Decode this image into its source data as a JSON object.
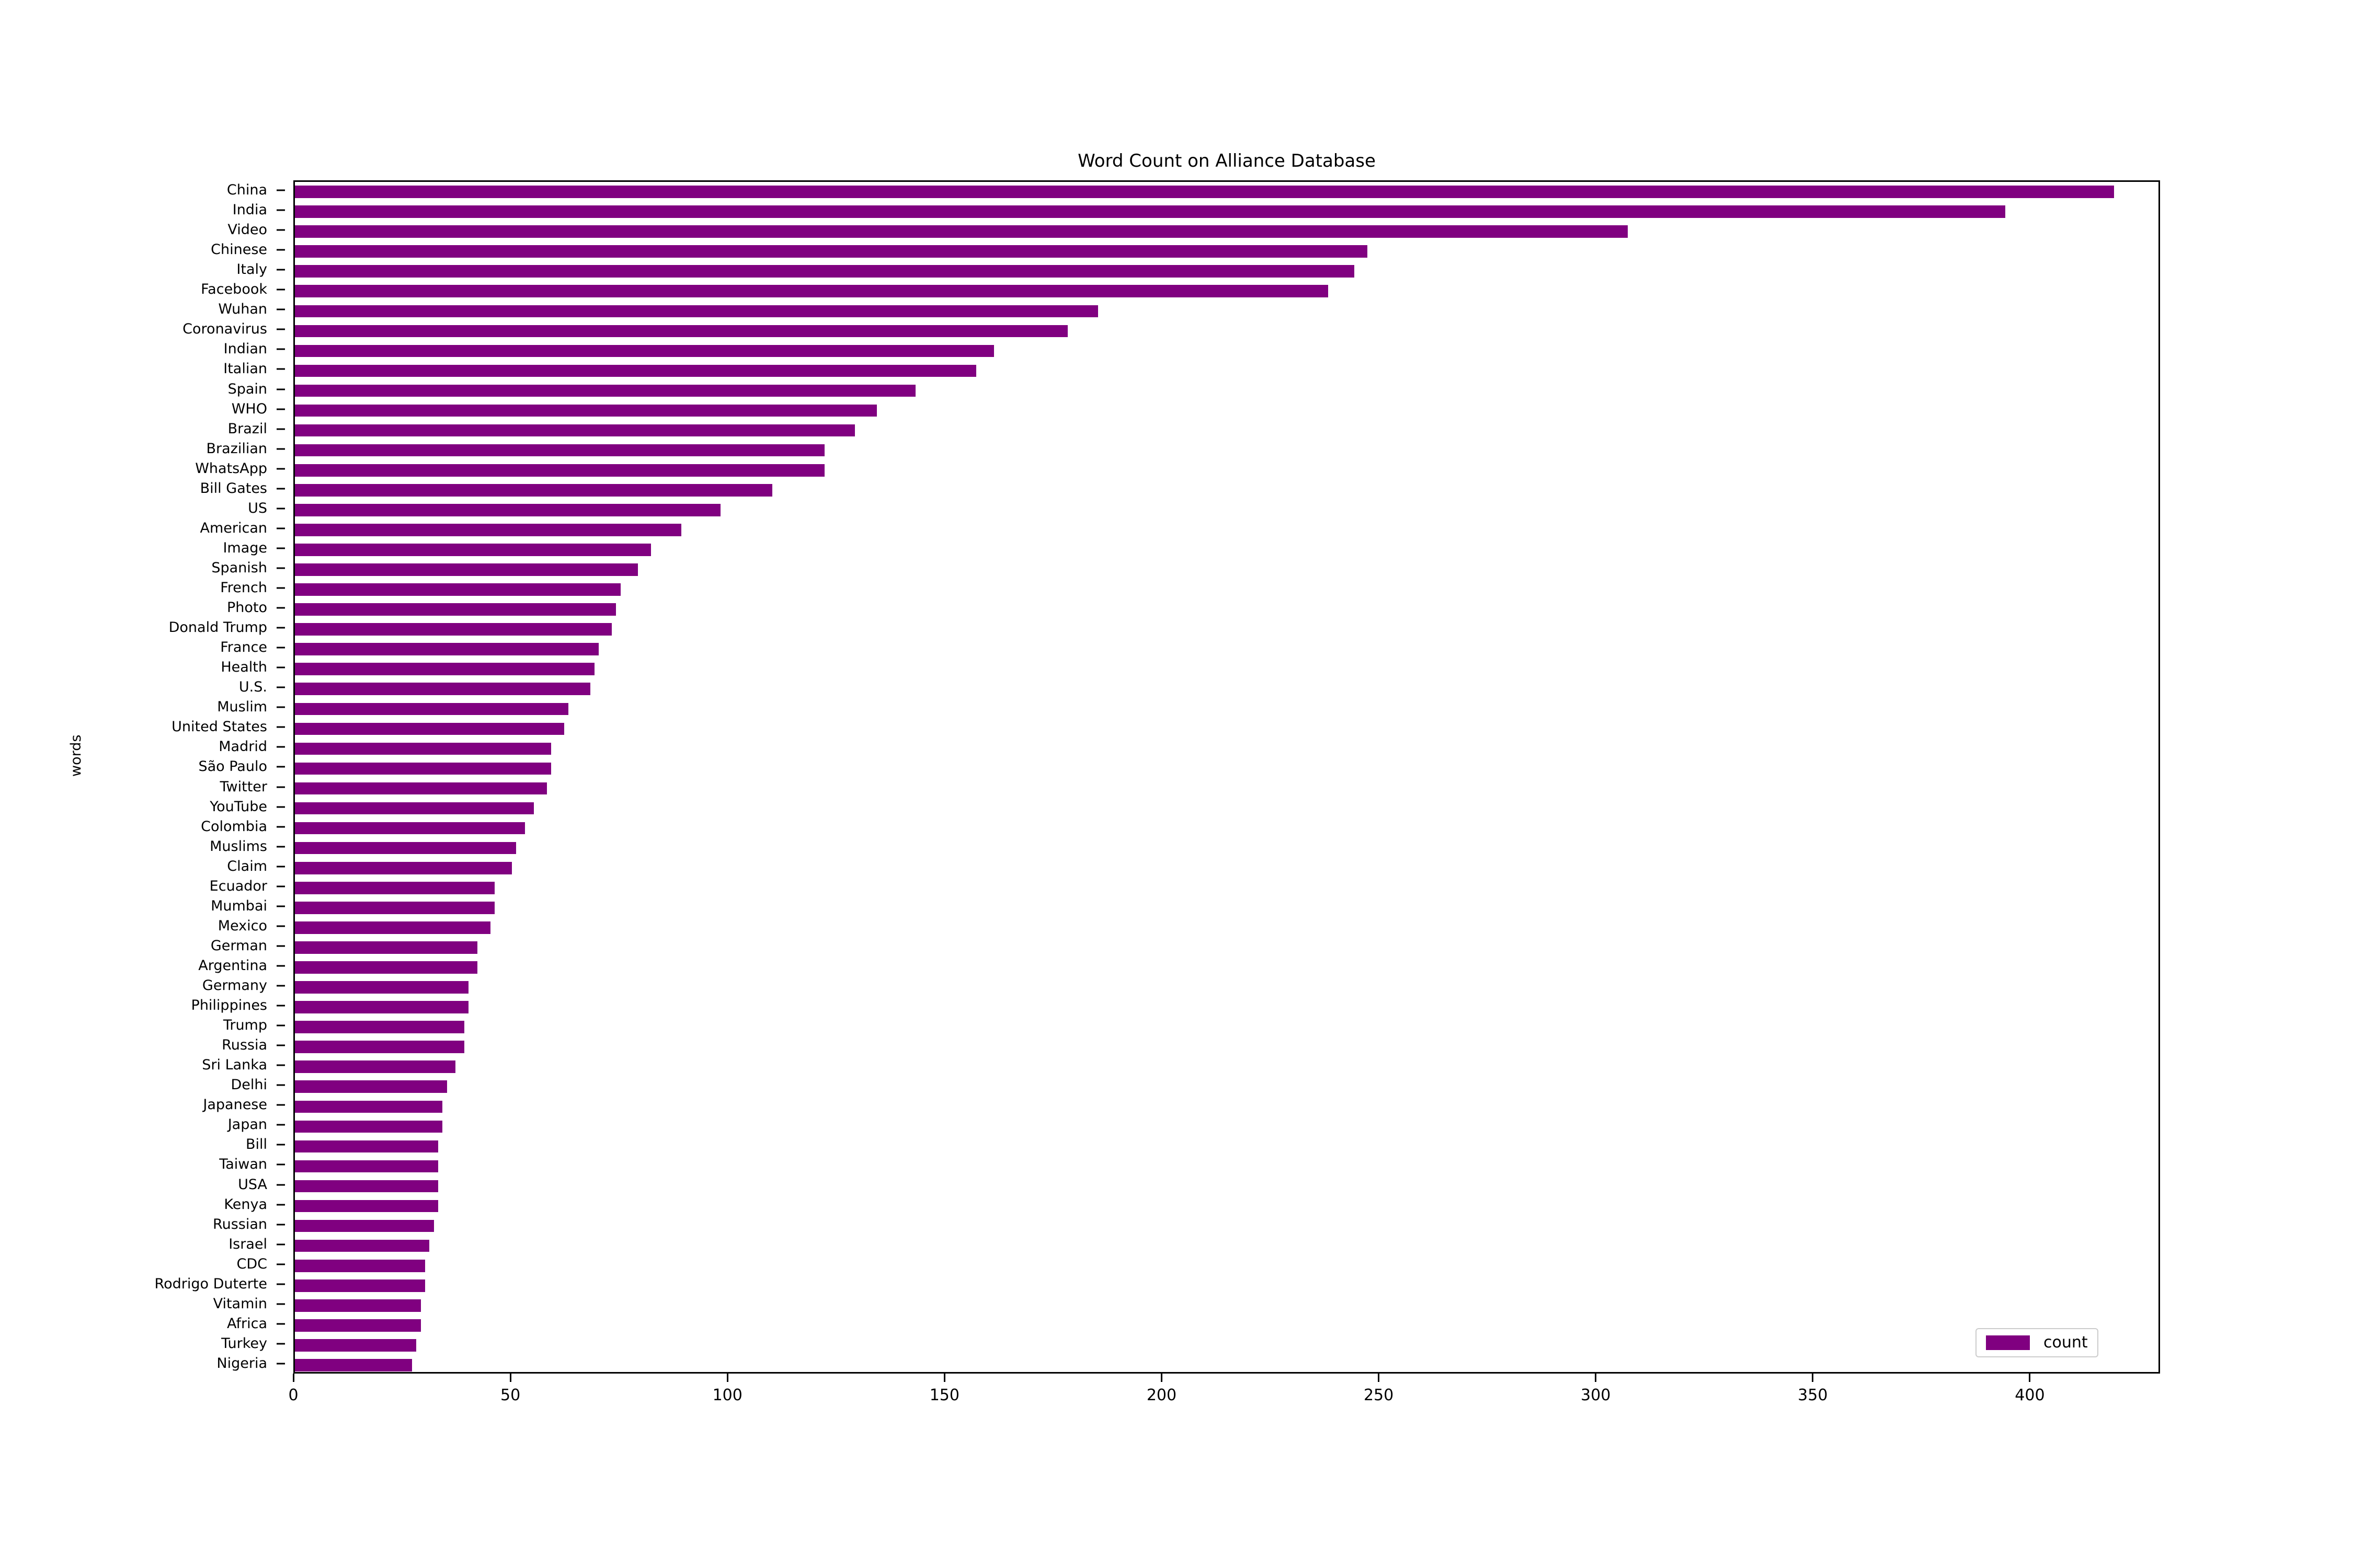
{
  "chart_data": {
    "type": "bar",
    "orientation": "horizontal",
    "title": "Word Count on Alliance Database",
    "xlabel": "",
    "ylabel": "words",
    "xlim": [
      0,
      430
    ],
    "xticks": [
      0,
      50,
      100,
      150,
      200,
      250,
      300,
      350,
      400
    ],
    "xtick_labels": [
      "0",
      "50",
      "100",
      "150",
      "200",
      "250",
      "300",
      "350",
      "400"
    ],
    "grid": false,
    "bar_color": "#800080",
    "legend": {
      "position": "lower right",
      "entries": [
        {
          "label": "count",
          "color": "#800080"
        }
      ]
    },
    "categories": [
      "China",
      "India",
      "Video",
      "Chinese",
      "Italy",
      "Facebook",
      "Wuhan",
      "Coronavirus",
      "Indian",
      "Italian",
      "Spain",
      "WHO",
      "Brazil",
      "Brazilian",
      "WhatsApp",
      "Bill Gates",
      "US",
      "American",
      "Image",
      "Spanish",
      "French",
      "Photo",
      "Donald Trump",
      "France",
      "Health",
      "U.S.",
      "Muslim",
      "United States",
      "Madrid",
      "São Paulo",
      "Twitter",
      "YouTube",
      "Colombia",
      "Muslims",
      "Claim",
      "Ecuador",
      "Mumbai",
      "Mexico",
      "German",
      "Argentina",
      "Germany",
      "Philippines",
      "Trump",
      "Russia",
      "Sri Lanka",
      "Delhi",
      "Japanese",
      "Japan",
      "Bill",
      "Taiwan",
      "USA",
      "Kenya",
      "Russian",
      "Israel",
      "CDC",
      "Rodrigo Duterte",
      "Vitamin",
      "Africa",
      "Turkey",
      "Nigeria"
    ],
    "series": [
      {
        "name": "count",
        "values": [
          419,
          394,
          307,
          247,
          244,
          238,
          185,
          178,
          161,
          157,
          143,
          134,
          129,
          122,
          122,
          110,
          98,
          89,
          82,
          79,
          75,
          74,
          73,
          70,
          69,
          68,
          63,
          62,
          59,
          59,
          58,
          55,
          53,
          51,
          50,
          46,
          46,
          45,
          42,
          42,
          40,
          40,
          39,
          39,
          37,
          35,
          34,
          34,
          33,
          33,
          33,
          33,
          32,
          31,
          30,
          30,
          29,
          29,
          28,
          27
        ]
      }
    ]
  }
}
